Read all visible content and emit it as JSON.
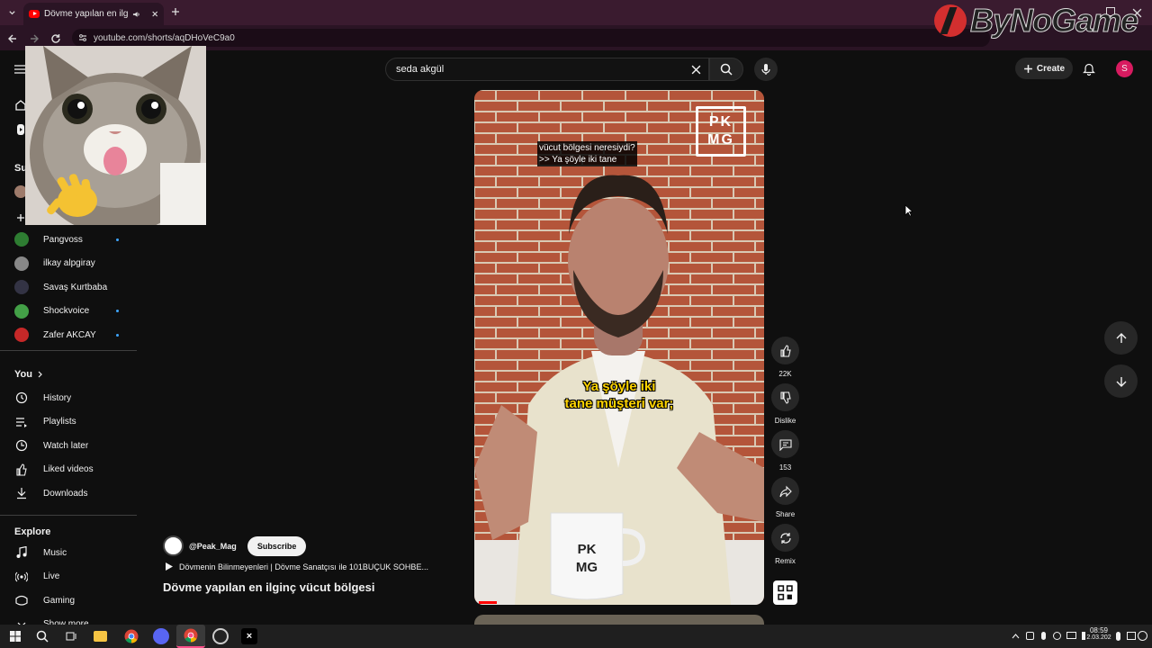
{
  "browser": {
    "tab_title": "Dövme yapılan en ilginç vüc",
    "url": "youtube.com/shorts/aqDHoVeC9a0"
  },
  "watermark": {
    "text": "ByNoGame"
  },
  "header": {
    "search_value": "seda akgül",
    "create_label": "Create",
    "avatar_letter": "S"
  },
  "sidebar": {
    "subscriptions_title": "Su",
    "channels": [
      {
        "name": "Pangvoss",
        "new": true,
        "color": "#2e7d32"
      },
      {
        "name": "ilkay alpgiray",
        "new": false,
        "color": "#888"
      },
      {
        "name": "Savaş Kurtbaba",
        "new": false,
        "color": "#334"
      },
      {
        "name": "Shockvoice",
        "new": true,
        "color": "#43a047"
      },
      {
        "name": "Zafer AKCAY",
        "new": true,
        "color": "#c62828"
      }
    ],
    "you_title": "You",
    "you_items": [
      "History",
      "Playlists",
      "Watch later",
      "Liked videos",
      "Downloads"
    ],
    "explore_title": "Explore",
    "explore_items": [
      "Music",
      "Live",
      "Gaming",
      "Show more"
    ]
  },
  "video": {
    "caption_top_1": "vücut bölgesi neresiydi?",
    "caption_top_2": ">> Ya şöyle iki tane",
    "caption_mid_1": "Ya şöyle iki",
    "caption_mid_2": "tane müşteri var;",
    "logo_line1": "PK",
    "logo_line2": "MG",
    "channel_handle": "@Peak_Mag",
    "subscribe_label": "Subscribe",
    "playlist_label": "Dövmenin Bilinmeyenleri | Dövme Sanatçısı ile 101BUÇUK SOHBE...",
    "title": "Dövme yapılan en ilginç vücut bölgesi"
  },
  "actions": {
    "likes": "22K",
    "dislike_label": "Dislike",
    "comments": "153",
    "share_label": "Share",
    "remix_label": "Remix"
  },
  "taskbar": {
    "time": "08:59",
    "date": "2.03.202"
  },
  "colors": {
    "accent": "#3ea6ff",
    "avatar": "#d81b60",
    "chrome_tab_bar": "#3a1b2f"
  }
}
